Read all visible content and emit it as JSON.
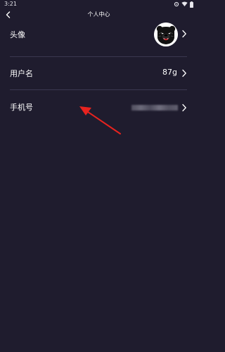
{
  "status_bar": {
    "time": "3:21",
    "icons": [
      "settings-icon",
      "wifi-icon",
      "battery-icon"
    ]
  },
  "header": {
    "title": "个人中心",
    "back_icon": "chevron-left-icon"
  },
  "rows": {
    "avatar": {
      "label": "头像"
    },
    "username": {
      "label": "用户名",
      "value": "87g"
    },
    "phone": {
      "label": "手机号",
      "value_masked": true
    }
  },
  "colors": {
    "background": "#1f1c2e",
    "divider": "#3b3850",
    "annotation_arrow": "#e8231f"
  }
}
